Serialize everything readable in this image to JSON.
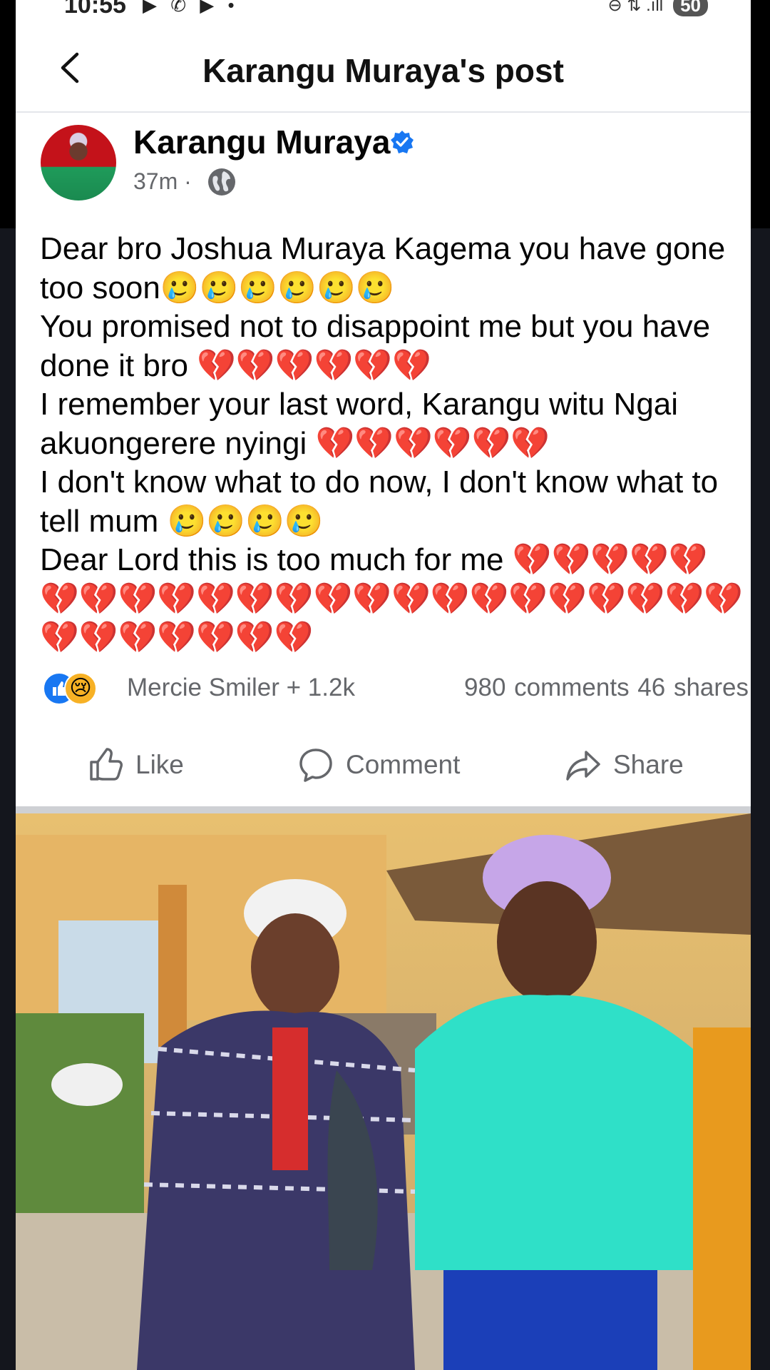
{
  "status_bar": {
    "time": "10:55",
    "left_icons": "▶ ✆ ▶ •",
    "right_icons": "⊖ ⇅ .ıll",
    "battery": "50"
  },
  "header": {
    "title": "Karangu Muraya's post"
  },
  "post": {
    "author": "Karangu Muraya",
    "time": "37m ·",
    "text": "Dear bro Joshua Muraya Kagema you have gone too soon🥲🥲🥲🥲🥲🥲\nYou promised not to disappoint me but you have done it bro 💔💔💔💔💔💔\nI remember your last word, Karangu witu Ngai akuongerere nyingi 💔💔💔💔💔💔\nI don't know what to do now, I don't know what to tell mum 🥲🥲🥲🥲\nDear Lord this is too much for me 💔💔💔💔💔💔💔💔💔💔💔💔💔💔💔💔💔💔💔💔💔💔💔💔💔💔💔💔💔💔",
    "reaction_names": "Mercie Smiler + 1.2k",
    "counts": "980 comments  46 shares"
  },
  "actions": {
    "like": "Like",
    "comment": "Comment",
    "share": "Share"
  },
  "colors": {
    "accent": "#1877f2",
    "secondary_text": "#65676b",
    "divider": "#ced0d4"
  },
  "icons": [
    "back-arrow-icon",
    "verified-badge-icon",
    "globe-icon",
    "like-reaction-icon",
    "sad-reaction-icon",
    "thumbs-up-icon",
    "comment-bubble-icon",
    "share-arrow-icon"
  ]
}
